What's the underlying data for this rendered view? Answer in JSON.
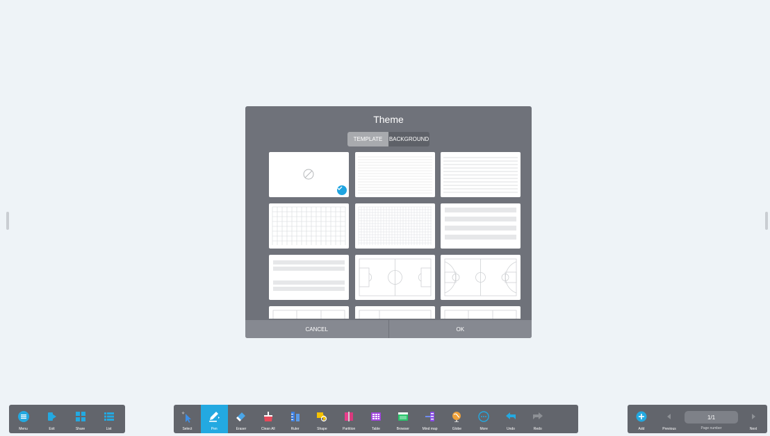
{
  "dialog": {
    "title": "Theme",
    "tabs": [
      {
        "label": "TEMPLATE",
        "active": true
      },
      {
        "label": "BACKGROUND",
        "active": false
      }
    ],
    "templates": [
      {
        "name": "blank",
        "selected": true
      },
      {
        "name": "lined-narrow"
      },
      {
        "name": "lined-wide"
      },
      {
        "name": "grid-large"
      },
      {
        "name": "grid-small"
      },
      {
        "name": "music-staff"
      },
      {
        "name": "staff-pairs"
      },
      {
        "name": "football-field"
      },
      {
        "name": "basketball-court"
      },
      {
        "name": "table-partial-1"
      },
      {
        "name": "table-partial-2"
      },
      {
        "name": "table-partial-3"
      }
    ],
    "cancel_label": "CANCEL",
    "ok_label": "OK"
  },
  "toolbar_left": [
    {
      "label": "Menu",
      "icon": "menu-icon"
    },
    {
      "label": "Exit",
      "icon": "exit-icon"
    },
    {
      "label": "Share",
      "icon": "share-icon"
    },
    {
      "label": "List",
      "icon": "list-icon"
    }
  ],
  "toolbar_center": [
    {
      "label": "Select",
      "icon": "select-icon"
    },
    {
      "label": "Pen",
      "icon": "pen-icon",
      "active": true
    },
    {
      "label": "Eraser",
      "icon": "eraser-icon"
    },
    {
      "label": "Clean All",
      "icon": "clean-all-icon"
    },
    {
      "label": "Ruler",
      "icon": "ruler-icon"
    },
    {
      "label": "Shape",
      "icon": "shape-icon"
    },
    {
      "label": "Partition",
      "icon": "partition-icon"
    },
    {
      "label": "Table",
      "icon": "table-icon"
    },
    {
      "label": "Browser",
      "icon": "browser-icon"
    },
    {
      "label": "Mind map",
      "icon": "mind-map-icon"
    },
    {
      "label": "Globe",
      "icon": "globe-icon"
    },
    {
      "label": "More",
      "icon": "more-icon"
    },
    {
      "label": "Undo",
      "icon": "undo-icon"
    },
    {
      "label": "Redo",
      "icon": "redo-icon"
    }
  ],
  "toolbar_right": {
    "add_label": "Add",
    "previous_label": "Previous",
    "page_value": "1/1",
    "page_caption": "Page number",
    "next_label": "Next"
  },
  "colors": {
    "accent": "#23a9e1",
    "dialog_bg": "#6f727a",
    "toolbar_bg": "#62656c"
  }
}
